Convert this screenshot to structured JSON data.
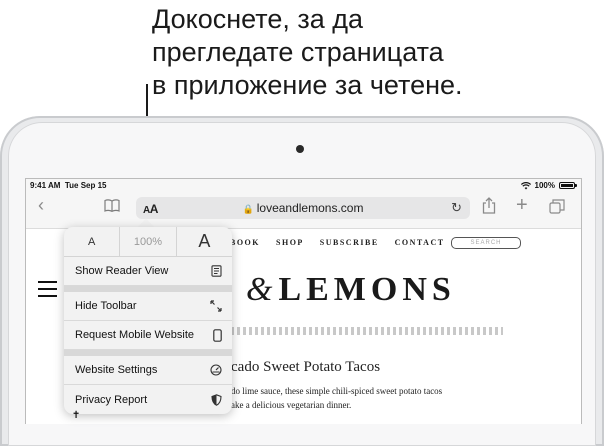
{
  "callout": {
    "lines": [
      "Докоснете, за да",
      "прегледате страницата",
      "в приложение за четене."
    ]
  },
  "status_bar": {
    "time": "9:41 AM",
    "date": "Tue Sep 15",
    "battery": "100%",
    "wifi_icon": "wifi-icon",
    "battery_icon": "battery-icon"
  },
  "toolbar": {
    "back_icon": "‹",
    "bookmarks_icon": "book-icon",
    "aa_small": "A",
    "aa_big": "A",
    "url": "loveandlemons.com",
    "reload_icon": "↻",
    "share_icon": "share-icon",
    "add_icon": "+",
    "tabs_icon": "tabs-icon"
  },
  "page": {
    "nav": [
      "BOOK",
      "SHOP",
      "SUBSCRIBE",
      "CONTACT"
    ],
    "search_placeholder": "SEARCH",
    "logo_amp": "&",
    "logo_text": "LEMONS",
    "post_title": "cado Sweet Potato Tacos",
    "excerpt_lines": [
      "do lime sauce, these simple chili-spiced sweet potato tacos",
      "ake a delicious vegetarian dinner."
    ]
  },
  "popover": {
    "font_smaller": "A",
    "zoom": "100%",
    "font_larger": "A",
    "items": [
      {
        "label": "Show Reader View",
        "icon": "reader-icon"
      },
      {
        "label": "Hide Toolbar",
        "icon": "arrows-diagonal-icon"
      },
      {
        "label": "Request Mobile Website",
        "icon": "phone-icon"
      },
      {
        "label": "Website Settings",
        "icon": "gauge-icon"
      },
      {
        "label": "Privacy Report",
        "icon": "shield-icon"
      }
    ]
  }
}
